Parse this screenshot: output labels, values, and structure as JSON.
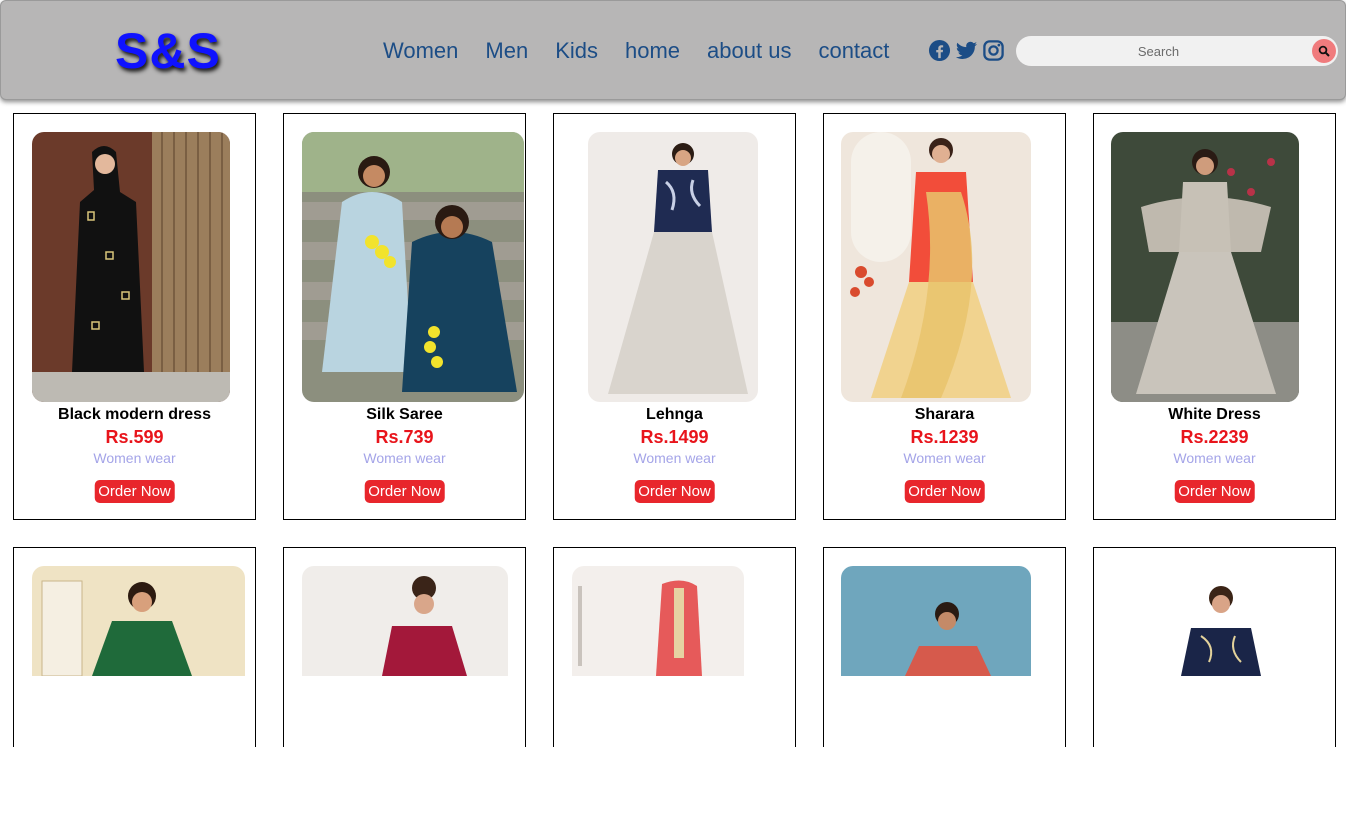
{
  "header": {
    "logo": "S&S",
    "nav": [
      "Women",
      "Men",
      "Kids",
      "home",
      "about us",
      "contact"
    ],
    "social_icons": [
      "facebook-icon",
      "twitter-icon",
      "instagram-icon"
    ],
    "search_placeholder": "Search",
    "search_icon": "search-icon"
  },
  "products": [
    {
      "title": "Black modern dress",
      "price": "Rs.599",
      "category": "Women wear",
      "button": "Order Now"
    },
    {
      "title": "Silk Saree",
      "price": "Rs.739",
      "category": "Women wear",
      "button": "Order Now"
    },
    {
      "title": "Lehnga",
      "price": "Rs.1499",
      "category": "Women wear",
      "button": "Order Now"
    },
    {
      "title": "Sharara",
      "price": "Rs.1239",
      "category": "Women wear",
      "button": "Order Now"
    },
    {
      "title": "White Dress",
      "price": "Rs.2239",
      "category": "Women wear",
      "button": "Order Now"
    }
  ],
  "colors": {
    "navbar": "#b7b6b6",
    "logo": "#0f12ff",
    "nav_link": "#1c4d86",
    "price": "#e8141b",
    "category": "#a4a4e8",
    "button": "#e8262c",
    "search_button": "#f07b7d"
  }
}
